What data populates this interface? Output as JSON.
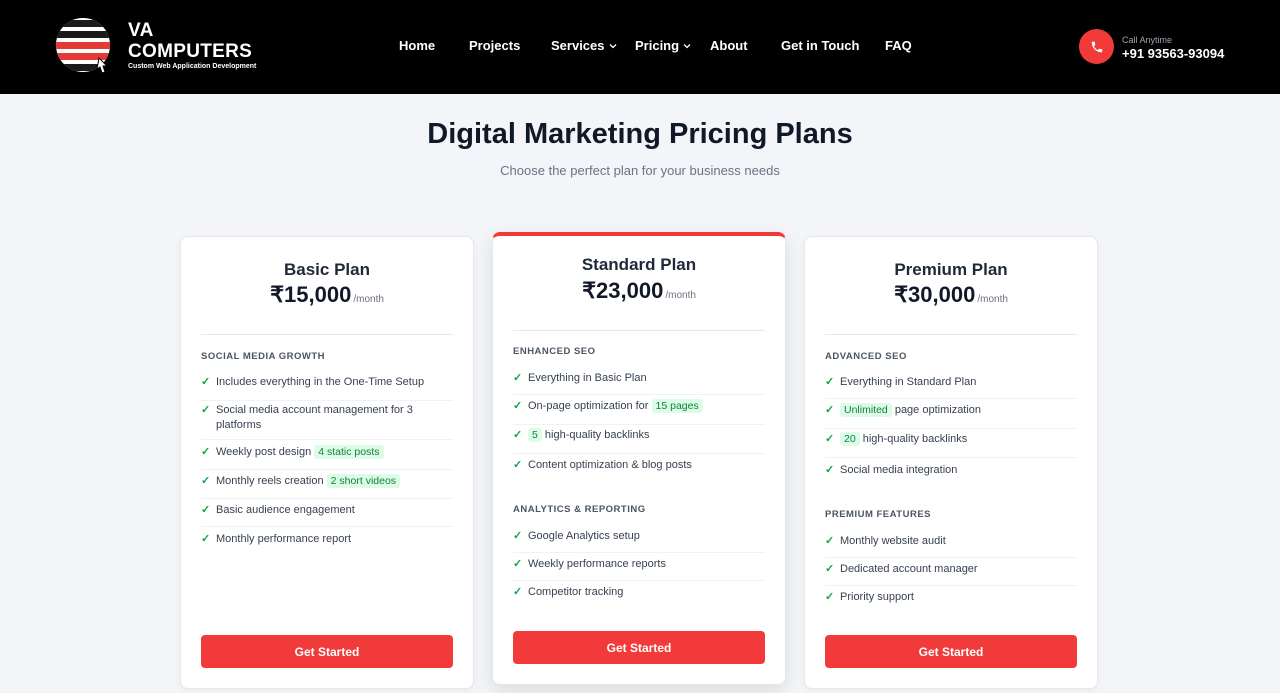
{
  "brand": {
    "title": "VA\nCOMPUTERS",
    "tagline": "Custom Web Application Development",
    "colors": {
      "accent": "#f23a3a",
      "nav_bg": "#000000",
      "highlight_bg": "#dcfce7",
      "check": "#16a34a"
    }
  },
  "nav": {
    "items": [
      {
        "label": "Home"
      },
      {
        "label": "Projects"
      },
      {
        "label": "Services",
        "has_dropdown": true
      },
      {
        "label": "Pricing",
        "has_dropdown": true
      },
      {
        "label": "About"
      },
      {
        "label": "Get in Touch"
      },
      {
        "label": "FAQ"
      }
    ],
    "call_label": "Call Anytime",
    "phone": "+91 93563-93094",
    "phone_icon": "phone-icon",
    "dropdown_icon": "chevron-down-icon"
  },
  "page": {
    "title": "Digital Marketing Pricing Plans",
    "subtitle": "Choose the perfect plan for your business needs"
  },
  "plans": [
    {
      "name": "Basic Plan",
      "price": "₹15,000",
      "unit": "/month",
      "featured": false,
      "sections": [
        {
          "heading": "SOCIAL MEDIA GROWTH",
          "features": [
            {
              "pre": "Includes everything in the One-Time Setup",
              "hl": "",
              "post": ""
            },
            {
              "pre": "Social media account management for 3 platforms",
              "hl": "",
              "post": ""
            },
            {
              "pre": "Weekly post design ",
              "hl": "4 static posts",
              "post": ""
            },
            {
              "pre": "Monthly reels creation ",
              "hl": "2 short videos",
              "post": ""
            },
            {
              "pre": "Basic audience engagement",
              "hl": "",
              "post": ""
            },
            {
              "pre": "Monthly performance report",
              "hl": "",
              "post": ""
            }
          ]
        }
      ],
      "cta": "Get Started"
    },
    {
      "name": "Standard Plan",
      "price": "₹23,000",
      "unit": "/month",
      "featured": true,
      "sections": [
        {
          "heading": "ENHANCED SEO",
          "features": [
            {
              "pre": "Everything in Basic Plan",
              "hl": "",
              "post": ""
            },
            {
              "pre": "On-page optimization for ",
              "hl": "15 pages",
              "post": ""
            },
            {
              "pre": "",
              "hl": "5",
              "post": " high-quality backlinks"
            },
            {
              "pre": "Content optimization & blog posts",
              "hl": "",
              "post": ""
            }
          ]
        },
        {
          "heading": "ANALYTICS & REPORTING",
          "features": [
            {
              "pre": "Google Analytics setup",
              "hl": "",
              "post": ""
            },
            {
              "pre": "Weekly performance reports",
              "hl": "",
              "post": ""
            },
            {
              "pre": "Competitor tracking",
              "hl": "",
              "post": ""
            }
          ]
        }
      ],
      "cta": "Get Started"
    },
    {
      "name": "Premium Plan",
      "price": "₹30,000",
      "unit": "/month",
      "featured": false,
      "sections": [
        {
          "heading": "ADVANCED SEO",
          "features": [
            {
              "pre": "Everything in Standard Plan",
              "hl": "",
              "post": ""
            },
            {
              "pre": "",
              "hl": "Unlimited",
              "post": " page optimization"
            },
            {
              "pre": "",
              "hl": "20",
              "post": " high-quality backlinks"
            },
            {
              "pre": "Social media integration",
              "hl": "",
              "post": ""
            }
          ]
        },
        {
          "heading": "PREMIUM FEATURES",
          "features": [
            {
              "pre": "Monthly website audit",
              "hl": "",
              "post": ""
            },
            {
              "pre": "Dedicated account manager",
              "hl": "",
              "post": ""
            },
            {
              "pre": "Priority support",
              "hl": "",
              "post": ""
            }
          ]
        }
      ],
      "cta": "Get Started"
    }
  ]
}
